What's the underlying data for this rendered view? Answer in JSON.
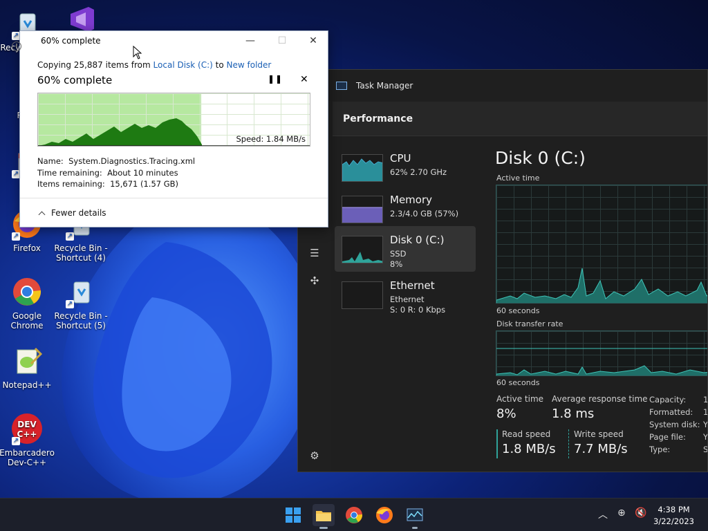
{
  "desktop": {
    "icons": [
      {
        "label": "Recycle Bin - Sh",
        "type": "recycle"
      },
      {
        "label": "Visual Studio",
        "type": "vs"
      },
      {
        "label": "Recy",
        "type": "recycle"
      },
      {
        "label": "Eve",
        "type": "event"
      },
      {
        "label": "Firefox",
        "type": "firefox"
      },
      {
        "label": "Recycle Bin - Shortcut (4)",
        "type": "recycle"
      },
      {
        "label": "Google Chrome",
        "type": "chrome"
      },
      {
        "label": "Recycle Bin - Shortcut (5)",
        "type": "recycle"
      },
      {
        "label": "Notepad++",
        "type": "notepad"
      },
      {
        "label": "Embarcadero Dev-C++",
        "type": "devcpp"
      }
    ]
  },
  "copy_dialog": {
    "title": "60% complete",
    "copy_prefix": "Copying 25,887 items from",
    "source": "Local Disk (C:)",
    "to_word": "to",
    "destination": "New folder",
    "headline": "60% complete",
    "progress": 0.6,
    "speed": "Speed: 1.84 MB/s",
    "details": [
      {
        "key": "Name:",
        "value": "System.Diagnostics.Tracing.xml"
      },
      {
        "key": "Time remaining:",
        "value": "About 10 minutes"
      },
      {
        "key": "Items remaining:",
        "value": "15,671 (1.57 GB)"
      }
    ],
    "fewer_details": "Fewer details"
  },
  "task_manager": {
    "title": "Task Manager",
    "section": "Performance",
    "resources": [
      {
        "name": "CPU",
        "line1": "62%  2.70 GHz",
        "line2": ""
      },
      {
        "name": "Memory",
        "line1": "2.3/4.0 GB (57%)",
        "line2": ""
      },
      {
        "name": "Disk 0 (C:)",
        "line1": "SSD",
        "line2": "8%"
      },
      {
        "name": "Ethernet",
        "line1": "Ethernet",
        "line2": "S: 0  R: 0 Kbps"
      }
    ],
    "disk": {
      "title": "Disk 0 (C:)",
      "active_time_label": "Active time",
      "seconds_label_1": "60 seconds",
      "transfer_label": "Disk transfer rate",
      "seconds_label_2": "60 seconds",
      "stats": [
        {
          "key": "Active time",
          "value": "8%"
        },
        {
          "key": "Average response time",
          "value": "1.8 ms"
        },
        {
          "key": "Read speed",
          "value": "1.8 MB/s"
        },
        {
          "key": "Write speed",
          "value": "7.7 MB/s"
        }
      ],
      "properties": [
        {
          "key": "Capacity:",
          "value": "1"
        },
        {
          "key": "Formatted:",
          "value": "1"
        },
        {
          "key": "System disk:",
          "value": "Y"
        },
        {
          "key": "Page file:",
          "value": "Y"
        },
        {
          "key": "Type:",
          "value": "S"
        }
      ]
    }
  },
  "taskbar": {
    "time": "4:38 PM",
    "date": "3/22/2023"
  },
  "colors": {
    "accent": "#2fa39a",
    "progress_green": "#b6e8a0",
    "link": "#1a5fb4"
  }
}
